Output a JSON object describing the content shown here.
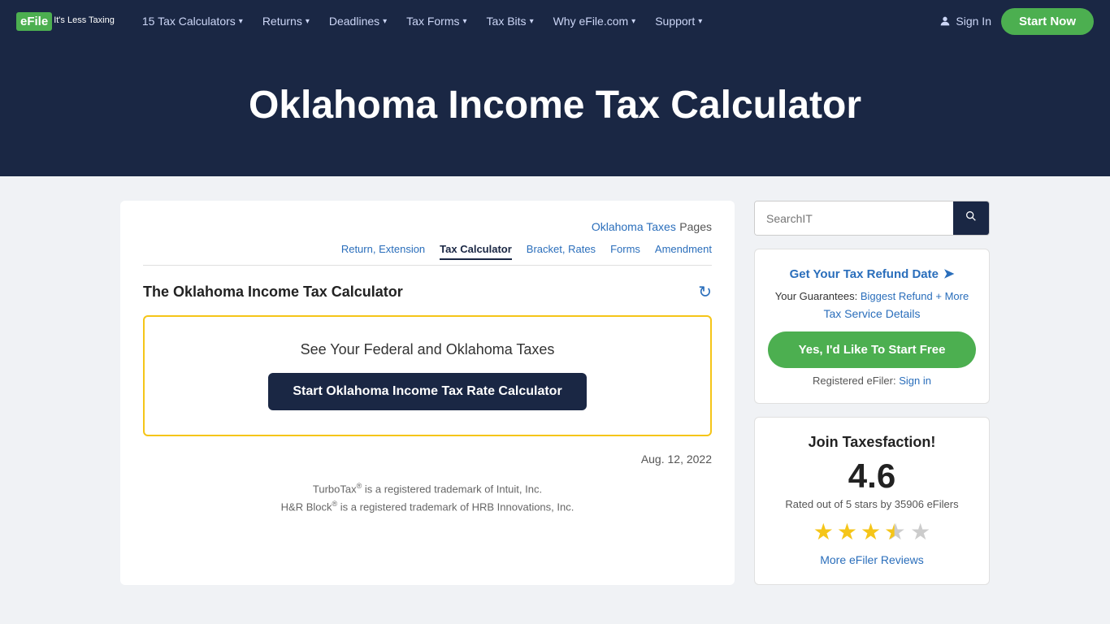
{
  "nav": {
    "logo_text": "eFile",
    "logo_sub": "It's Less Taxing",
    "items": [
      {
        "label": "15 Tax Calculators",
        "has_dropdown": true
      },
      {
        "label": "Returns",
        "has_dropdown": true
      },
      {
        "label": "Deadlines",
        "has_dropdown": true
      },
      {
        "label": "Tax Forms",
        "has_dropdown": true
      },
      {
        "label": "Tax Bits",
        "has_dropdown": true
      },
      {
        "label": "Why eFile.com",
        "has_dropdown": true
      },
      {
        "label": "Support",
        "has_dropdown": true
      }
    ],
    "sign_in_label": "Sign In",
    "start_now_label": "Start Now"
  },
  "hero": {
    "title": "Oklahoma Income Tax Calculator"
  },
  "breadcrumb": {
    "pages_label": "Oklahoma Taxes",
    "pages_suffix": " Pages",
    "tabs": [
      {
        "label": "Return, Extension",
        "active": false
      },
      {
        "label": "Tax Calculator",
        "active": true
      },
      {
        "label": "Bracket, Rates",
        "active": false
      },
      {
        "label": "Forms",
        "active": false
      },
      {
        "label": "Amendment",
        "active": false
      }
    ]
  },
  "calculator": {
    "section_title": "The Oklahoma Income Tax Calculator",
    "tagline": "See Your Federal and Oklahoma Taxes",
    "cta_button": "Start Oklahoma Income Tax Rate Calculator",
    "date_note": "Aug. 12, 2022",
    "footnote1": "TurboTax® is a registered trademark of Intuit, Inc.",
    "footnote2": "H&R Block® is a registered trademark of HRB Innovations, Inc."
  },
  "sidebar": {
    "search_placeholder": "SearchIT",
    "refund": {
      "link_text": "Get Your Tax Refund Date",
      "guarantees_label": "Your Guarantees:",
      "guarantees_link": "Biggest Refund + More",
      "tax_service_label": "Tax Service Details",
      "start_free_btn": "Yes, I'd Like To Start Free",
      "registered_text": "Registered eFiler:",
      "sign_in_text": "Sign in"
    },
    "rating": {
      "title": "Join Taxesfaction!",
      "score": "4.6",
      "description": "Rated out of 5 stars by 35906 eFilers",
      "full_stars": 3,
      "half_star": true,
      "empty_stars": 1,
      "reviews_link": "More eFiler Reviews"
    }
  }
}
